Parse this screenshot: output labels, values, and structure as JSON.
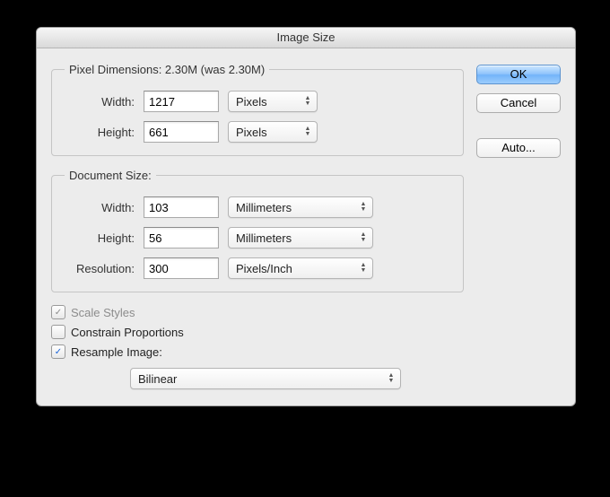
{
  "title": "Image Size",
  "pixelDimensions": {
    "legend": "Pixel Dimensions:  2.30M (was 2.30M)",
    "widthLabel": "Width:",
    "widthValue": "1217",
    "widthUnit": "Pixels",
    "heightLabel": "Height:",
    "heightValue": "661",
    "heightUnit": "Pixels"
  },
  "documentSize": {
    "legend": "Document Size:",
    "widthLabel": "Width:",
    "widthValue": "103",
    "widthUnit": "Millimeters",
    "heightLabel": "Height:",
    "heightValue": "56",
    "heightUnit": "Millimeters",
    "resolutionLabel": "Resolution:",
    "resolutionValue": "300",
    "resolutionUnit": "Pixels/Inch"
  },
  "checks": {
    "scaleStyles": "Scale Styles",
    "constrain": "Constrain Proportions",
    "resample": "Resample Image:"
  },
  "resampleMethod": "Bilinear",
  "buttons": {
    "ok": "OK",
    "cancel": "Cancel",
    "auto": "Auto..."
  }
}
